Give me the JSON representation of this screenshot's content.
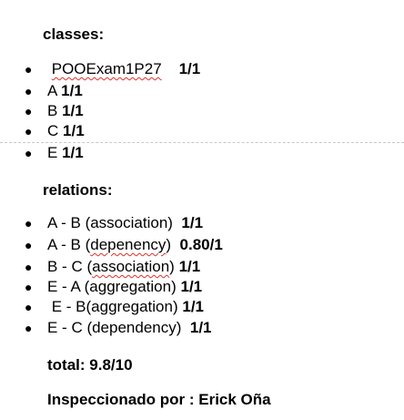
{
  "classes": {
    "heading": "classes:",
    "items": [
      {
        "lead": " ",
        "name": "POOExam1P27",
        "sep": "    ",
        "score": "1/1"
      },
      {
        "name": "A",
        "sep": " ",
        "score": "1/1"
      },
      {
        "name": "B",
        "sep": " ",
        "score": "1/1"
      },
      {
        "name": "C",
        "sep": " ",
        "score": "1/1"
      },
      {
        "name": "E",
        "sep": " ",
        "score": "1/1"
      }
    ]
  },
  "relations": {
    "heading": "relations:",
    "items": [
      {
        "text_before": "A - B (association)  ",
        "score": "1/1"
      },
      {
        "text_before": "A - B (",
        "flag": "depenency",
        "text_after": ")  ",
        "score": "0.80/1"
      },
      {
        "text_before": "B - C (",
        "flag": "association",
        "text_after": ") ",
        "score": "1/1"
      },
      {
        "text_before": "E - A (aggregation) ",
        "score": "1/1"
      },
      {
        "text_before": " E - B(aggregation) ",
        "score": "1/1"
      },
      {
        "text_before": "E - C (dependency)  ",
        "score": "1/1"
      }
    ]
  },
  "total": "total: 9.8/10",
  "inspected_by": "Inspeccionado por : Erick Oña"
}
